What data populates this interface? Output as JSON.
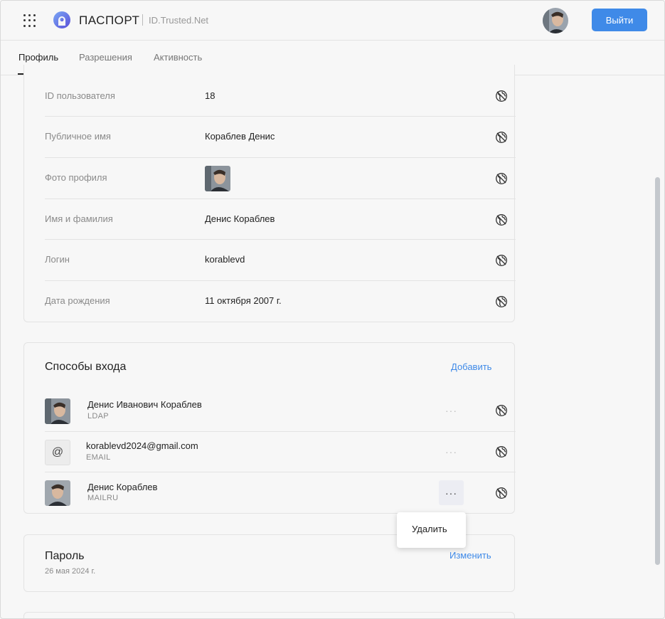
{
  "header": {
    "logo_text": "ПАСПОРТ",
    "logo_sub": "ID.Trusted.Net",
    "logout_label": "Выйти",
    "brand_color": "#3f8ae8"
  },
  "tabs": [
    {
      "label": "Профиль",
      "active": true
    },
    {
      "label": "Разрешения",
      "active": false
    },
    {
      "label": "Активность",
      "active": false
    }
  ],
  "profile": {
    "rows": [
      {
        "label": "ID пользователя",
        "value": "18"
      },
      {
        "label": "Публичное имя",
        "value": "Кораблев Денис"
      },
      {
        "label": "Фото профиля",
        "value": ""
      },
      {
        "label": "Имя и фамилия",
        "value": "Денис Кораблев"
      },
      {
        "label": "Логин",
        "value": "korablevd"
      },
      {
        "label": "Дата рождения",
        "value": "11 октября 2007 г."
      }
    ]
  },
  "login_methods": {
    "title": "Способы входа",
    "add_label": "Добавить",
    "items": [
      {
        "name": "Денис Иванович Кораблев",
        "type": "LDAP",
        "icon": "avatar"
      },
      {
        "name": "korablevd2024@gmail.com",
        "type": "EMAIL",
        "icon": "at-icon",
        "icon_glyph": "@"
      },
      {
        "name": "Денис Кораблев",
        "type": "MAILRU",
        "icon": "avatar"
      }
    ],
    "menu": {
      "delete_label": "Удалить"
    }
  },
  "password": {
    "title": "Пароль",
    "date": "26 мая 2024 г.",
    "change_label": "Изменить"
  },
  "icons": {
    "apps": "grid-dots-icon",
    "logo": "passport-logo-icon",
    "visibility": "globe-off-icon",
    "more": "more-horizontal-icon"
  }
}
